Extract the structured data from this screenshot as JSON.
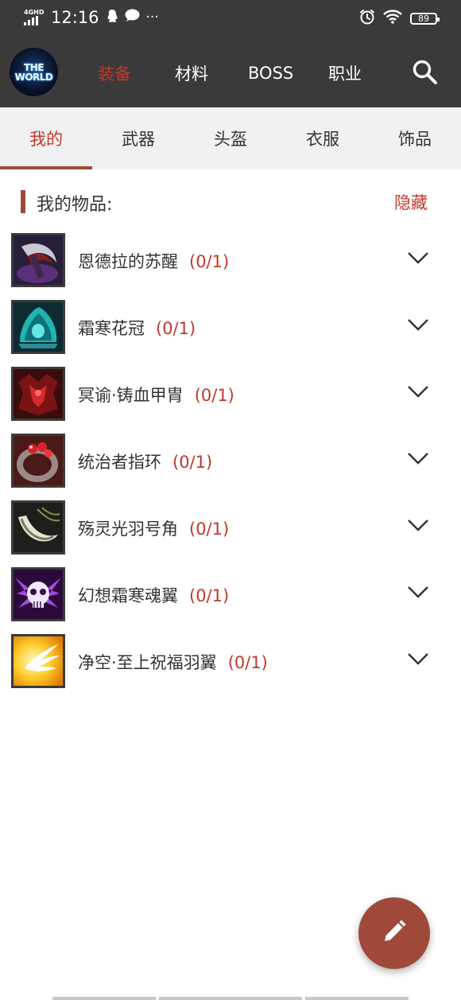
{
  "status": {
    "network_tag": "4GHD",
    "time": "12:16",
    "more_indicator": "···",
    "battery": "89"
  },
  "header": {
    "logo_text_line1": "THE",
    "logo_text_line2": "WORLD",
    "nav": [
      "装备",
      "材料",
      "BOSS",
      "职业"
    ],
    "active_nav": "装备"
  },
  "tabs": [
    "我的",
    "武器",
    "头盔",
    "衣服",
    "饰品"
  ],
  "section": {
    "title": "我的物品:",
    "hide_label": "隐藏"
  },
  "items": [
    {
      "name": "恩德拉的苏醒",
      "count": "(0/1)",
      "icon": "purple-scythe-icon"
    },
    {
      "name": "霜寒花冠",
      "count": "(0/1)",
      "icon": "frost-crown-icon"
    },
    {
      "name": "冥谕·铸血甲胄",
      "count": "(0/1)",
      "icon": "blood-armor-icon"
    },
    {
      "name": "统治者指环",
      "count": "(0/1)",
      "icon": "ruby-ring-icon"
    },
    {
      "name": "殇灵光羽号角",
      "count": "(0/1)",
      "icon": "horn-icon"
    },
    {
      "name": "幻想霜寒魂翼",
      "count": "(0/1)",
      "icon": "skull-wings-icon"
    },
    {
      "name": "净空·至上祝福羽翼",
      "count": "(0/1)",
      "icon": "golden-wings-icon"
    }
  ],
  "colors": {
    "accent": "#c0392b",
    "header_bg": "#3a3a3a",
    "tab_bg": "#f1f1f3",
    "fab": "#a0493a"
  }
}
